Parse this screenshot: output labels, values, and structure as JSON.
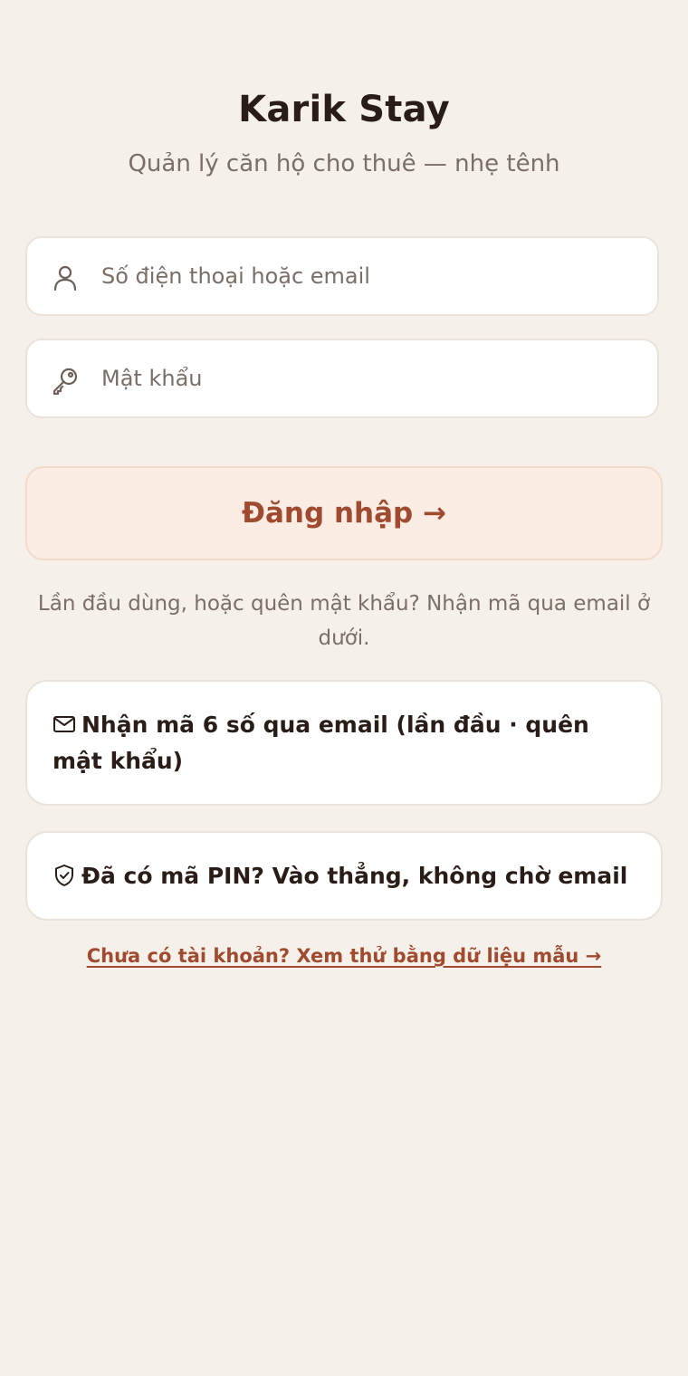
{
  "app": {
    "title": "Karik Stay",
    "subtitle": "Quản lý căn hộ cho thuê — nhẹ tênh"
  },
  "login_form": {
    "identifier_placeholder": "Số điện thoại hoặc email",
    "identifier_value": "",
    "identifier_icon": "user-icon",
    "password_placeholder": "Mật khẩu",
    "password_value": "",
    "password_icon": "key-icon",
    "submit_label": "Đăng nhập →"
  },
  "hint_text": "Lần đầu dùng, hoặc quên mật khẩu? Nhận mã qua email ở dưới.",
  "options": {
    "email_otp": {
      "icon": "mail-icon",
      "label": "Nhận mã 6 số qua email (lần đầu · quên mật khẩu)"
    },
    "pin_login": {
      "icon": "shield-check-icon",
      "label": "Đã có mã PIN? Vào thẳng, không chờ email"
    }
  },
  "demo_link": "Chưa có tài khoản? Xem thử bằng dữ liệu mẫu →",
  "colors": {
    "background": "#f5f0ea",
    "accent": "#a04a2f",
    "accent_bg": "#fbece4",
    "text": "#2a1d17",
    "muted": "#7a6e66"
  }
}
